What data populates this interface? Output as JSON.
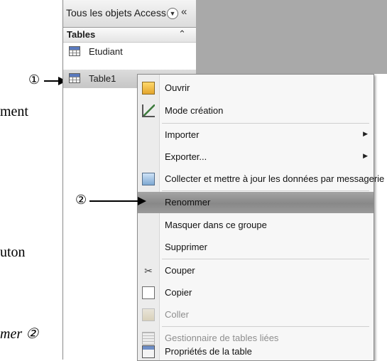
{
  "document_fragments": {
    "frag1": "ment",
    "frag2": "uton",
    "frag3": "mer ②"
  },
  "callouts": {
    "callout1": "①",
    "callout2": "②"
  },
  "nav_pane": {
    "title": "Tous les objets Access",
    "dropdown_icon": "chevron-down-circle-icon",
    "collapse_icon": "«",
    "group": {
      "title": "Tables",
      "collapse_icon": "»"
    },
    "items": [
      {
        "label": "Etudiant",
        "icon": "table-icon"
      },
      {
        "label": "Table1",
        "icon": "table-icon",
        "selected": true
      }
    ]
  },
  "context_menu": {
    "items": [
      {
        "label": "Ouvrir",
        "icon": "open-icon"
      },
      {
        "label": "Mode création",
        "icon": "design-view-icon"
      },
      {
        "label": "Importer",
        "submenu": "▶"
      },
      {
        "label": "Exporter...",
        "submenu": "▶"
      },
      {
        "label": "Collecter et mettre à jour les données par messagerie",
        "icon": "collect-data-icon"
      },
      {
        "label": "Renommer",
        "highlighted": true
      },
      {
        "label": "Masquer dans ce groupe"
      },
      {
        "label": "Supprimer"
      },
      {
        "label": "Couper",
        "icon": "scissors-icon"
      },
      {
        "label": "Copier",
        "icon": "copy-icon"
      },
      {
        "label": "Coller",
        "icon": "paste-icon",
        "disabled": true
      },
      {
        "label": "Gestionnaire de tables liées",
        "icon": "linked-table-manager-icon",
        "disabled": true
      },
      {
        "label": "Propriétés de la table",
        "icon": "properties-icon"
      }
    ]
  },
  "colors": {
    "highlight": "#999999",
    "gray_background": "#a9a9a9"
  }
}
